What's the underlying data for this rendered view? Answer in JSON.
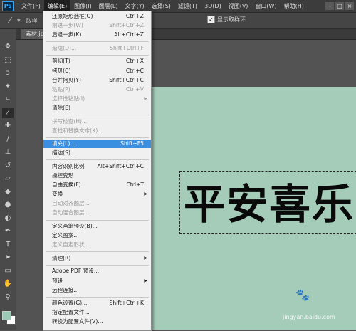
{
  "app": {
    "logo": "Ps"
  },
  "menubar": {
    "items": [
      "文件(F)",
      "编辑(E)",
      "图像(I)",
      "图层(L)",
      "文字(Y)",
      "选择(S)",
      "滤镜(T)",
      "3D(D)",
      "视图(V)",
      "窗口(W)",
      "帮助(H)"
    ],
    "active": "编辑(E)"
  },
  "options": {
    "sample_label": "取样",
    "show_ring_label": "显示取样环",
    "show_ring_checked": true
  },
  "document": {
    "tab_label": "素材.jpg"
  },
  "canvas": {
    "text": "平安喜乐",
    "bg_color": "#a4ccb9"
  },
  "edit_menu": {
    "groups": [
      [
        {
          "label": "还原矩形选框(O)",
          "shortcut": "Ctrl+Z",
          "disabled": false
        },
        {
          "label": "前进一步(W)",
          "shortcut": "Shift+Ctrl+Z",
          "disabled": true
        },
        {
          "label": "后退一步(K)",
          "shortcut": "Alt+Ctrl+Z",
          "disabled": false
        }
      ],
      [
        {
          "label": "渐隐(D)...",
          "shortcut": "Shift+Ctrl+F",
          "disabled": true
        }
      ],
      [
        {
          "label": "剪切(T)",
          "shortcut": "Ctrl+X",
          "disabled": false
        },
        {
          "label": "拷贝(C)",
          "shortcut": "Ctrl+C",
          "disabled": false
        },
        {
          "label": "合并拷贝(Y)",
          "shortcut": "Shift+Ctrl+C",
          "disabled": false
        },
        {
          "label": "粘贴(P)",
          "shortcut": "Ctrl+V",
          "disabled": true
        },
        {
          "label": "选择性粘贴(I)",
          "shortcut": "",
          "submenu": true,
          "disabled": true
        },
        {
          "label": "清除(E)",
          "shortcut": "",
          "disabled": false
        }
      ],
      [
        {
          "label": "拼写检查(H)...",
          "shortcut": "",
          "disabled": true
        },
        {
          "label": "查找和替换文本(X)...",
          "shortcut": "",
          "disabled": true
        }
      ],
      [
        {
          "label": "填充(L)...",
          "shortcut": "Shift+F5",
          "disabled": false,
          "highlighted": true
        },
        {
          "label": "描边(S)...",
          "shortcut": "",
          "disabled": false
        }
      ],
      [
        {
          "label": "内容识别比例",
          "shortcut": "Alt+Shift+Ctrl+C",
          "disabled": false
        },
        {
          "label": "操控变形",
          "shortcut": "",
          "disabled": false
        },
        {
          "label": "自由变换(F)",
          "shortcut": "Ctrl+T",
          "disabled": false
        },
        {
          "label": "变换",
          "shortcut": "",
          "submenu": true,
          "disabled": false
        },
        {
          "label": "自动对齐图层...",
          "shortcut": "",
          "disabled": true
        },
        {
          "label": "自动混合图层...",
          "shortcut": "",
          "disabled": true
        }
      ],
      [
        {
          "label": "定义画笔预设(B)...",
          "shortcut": "",
          "disabled": false
        },
        {
          "label": "定义图案...",
          "shortcut": "",
          "disabled": false
        },
        {
          "label": "定义自定形状...",
          "shortcut": "",
          "disabled": true
        }
      ],
      [
        {
          "label": "清理(R)",
          "shortcut": "",
          "submenu": true,
          "disabled": false
        }
      ],
      [
        {
          "label": "Adobe PDF 预设...",
          "shortcut": "",
          "disabled": false
        },
        {
          "label": "预设",
          "shortcut": "",
          "submenu": true,
          "disabled": false
        },
        {
          "label": "远程连接...",
          "shortcut": "",
          "disabled": false
        }
      ],
      [
        {
          "label": "颜色设置(G)...",
          "shortcut": "Shift+Ctrl+K",
          "disabled": false
        },
        {
          "label": "指定配置文件...",
          "shortcut": "",
          "disabled": false
        },
        {
          "label": "转换为配置文件(V)...",
          "shortcut": "",
          "disabled": false
        }
      ]
    ]
  },
  "tools": [
    {
      "icon": "move-icon",
      "glyph": "✥"
    },
    {
      "icon": "marquee-icon",
      "glyph": "⬚"
    },
    {
      "icon": "lasso-icon",
      "glyph": "ↄ"
    },
    {
      "icon": "magic-wand-icon",
      "glyph": "✦"
    },
    {
      "icon": "crop-icon",
      "glyph": "⌗"
    },
    {
      "icon": "eyedropper-icon",
      "glyph": "⁄"
    },
    {
      "icon": "healing-icon",
      "glyph": "✚"
    },
    {
      "icon": "brush-icon",
      "glyph": "∕"
    },
    {
      "icon": "stamp-icon",
      "glyph": "⊥"
    },
    {
      "icon": "history-brush-icon",
      "glyph": "↺"
    },
    {
      "icon": "eraser-icon",
      "glyph": "▱"
    },
    {
      "icon": "bucket-icon",
      "glyph": "◆"
    },
    {
      "icon": "blur-icon",
      "glyph": "●"
    },
    {
      "icon": "dodge-icon",
      "glyph": "◐"
    },
    {
      "icon": "pen-icon",
      "glyph": "✒"
    },
    {
      "icon": "type-icon",
      "glyph": "T"
    },
    {
      "icon": "path-select-icon",
      "glyph": "➤"
    },
    {
      "icon": "shape-icon",
      "glyph": "▭"
    },
    {
      "icon": "hand-icon",
      "glyph": "✋"
    },
    {
      "icon": "zoom-icon",
      "glyph": "⚲"
    }
  ],
  "watermark": {
    "logo_text": "Bai",
    "text": "jingyan.baidu.com"
  }
}
